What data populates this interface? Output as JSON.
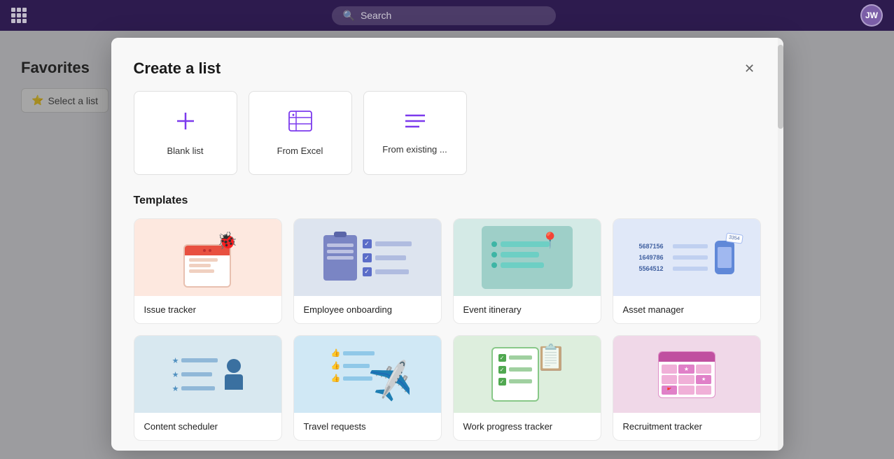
{
  "topbar": {
    "search_placeholder": "Search",
    "avatar_initials": "JW"
  },
  "bg": {
    "title": "Favorites",
    "select_label": "Select a list"
  },
  "modal": {
    "title": "Create a list",
    "options": [
      {
        "id": "blank",
        "label": "Blank list",
        "icon": "+"
      },
      {
        "id": "excel",
        "label": "From Excel",
        "icon": "excel"
      },
      {
        "id": "existing",
        "label": "From existing ...",
        "icon": "lines"
      }
    ],
    "templates_section": "Templates",
    "templates": [
      {
        "id": "issue-tracker",
        "label": "Issue tracker"
      },
      {
        "id": "employee-onboarding",
        "label": "Employee onboarding"
      },
      {
        "id": "event-itinerary",
        "label": "Event itinerary"
      },
      {
        "id": "asset-manager",
        "label": "Asset manager"
      },
      {
        "id": "content-scheduler",
        "label": "Content scheduler"
      },
      {
        "id": "travel-requests",
        "label": "Travel requests"
      },
      {
        "id": "work-progress-tracker",
        "label": "Work progress tracker"
      },
      {
        "id": "recruitment-tracker",
        "label": "Recruitment tracker"
      }
    ]
  }
}
